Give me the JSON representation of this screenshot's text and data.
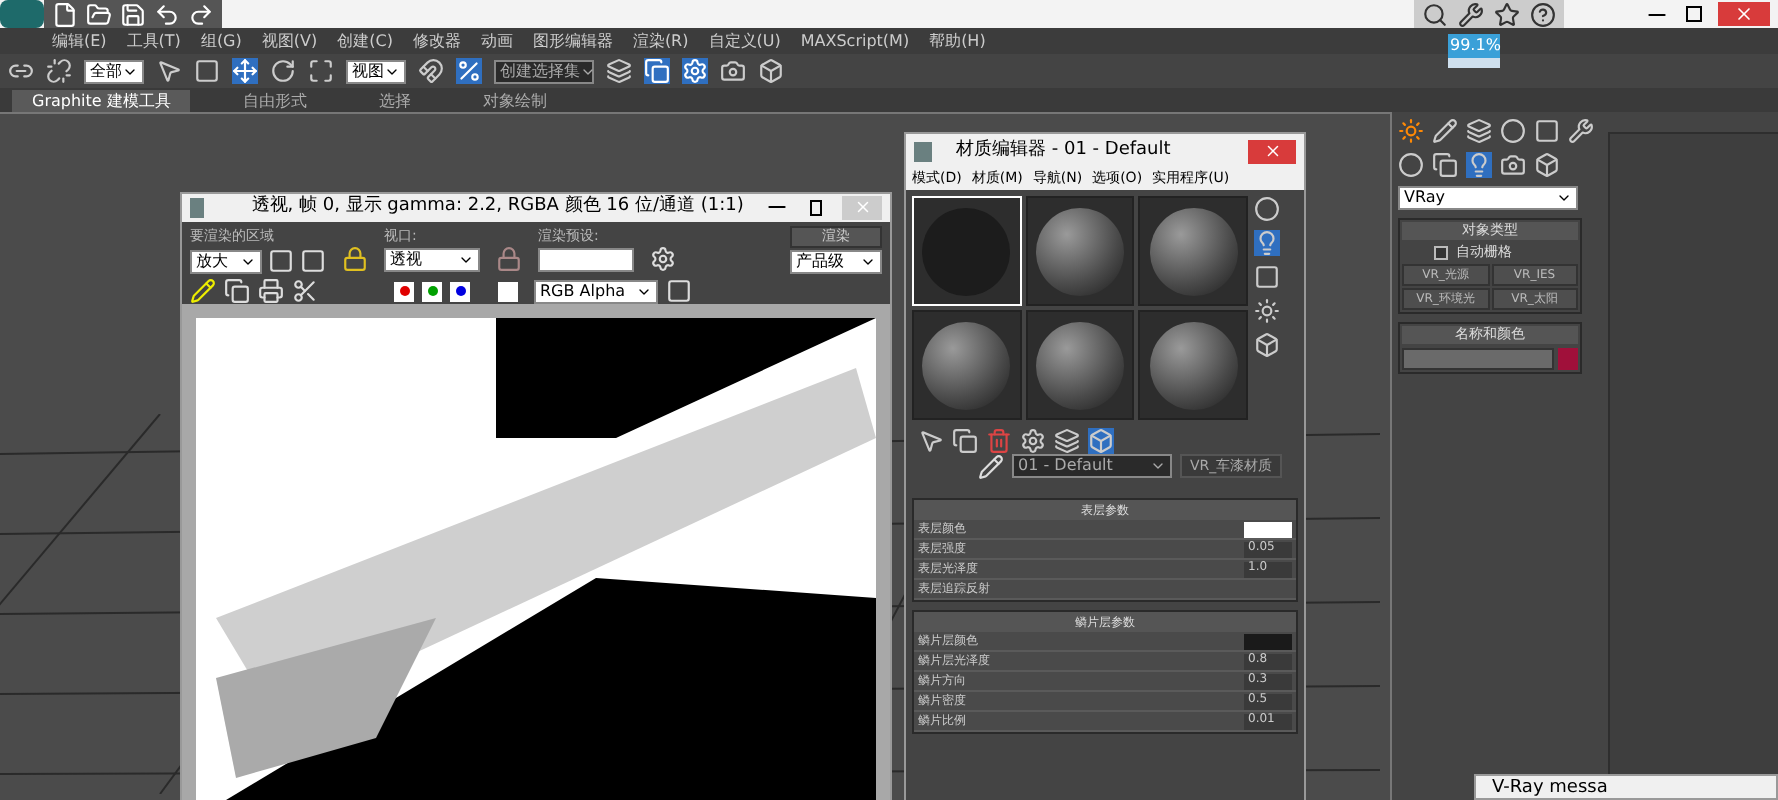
{
  "app": {
    "progress": "99.1%"
  },
  "menu": [
    "编辑(E)",
    "工具(T)",
    "组(G)",
    "视图(V)",
    "创建(C)",
    "修改器",
    "动画",
    "图形编辑器",
    "渲染(R)",
    "自定义(U)",
    "MAXScript(M)",
    "帮助(H)"
  ],
  "toolbar": {
    "filter": "全部",
    "coord": "视图",
    "selection_set": "创建选择集"
  },
  "ribbon_tabs": [
    {
      "label": "Graphite 建模工具",
      "selected": true
    },
    {
      "label": "自由形式",
      "selected": false
    },
    {
      "label": "选择",
      "selected": false
    },
    {
      "label": "对象绘制",
      "selected": false
    }
  ],
  "render_window": {
    "title": "透视, 帧 0, 显示 gamma: 2.2, RGBA 颜色 16 位/通道 (1:1)",
    "area_label": "要渲染的区域",
    "area_value": "放大",
    "viewport_label": "视口:",
    "viewport_value": "透视",
    "preset_label": "渲染预设:",
    "render_button": "渲染",
    "quality_value": "产品级",
    "channel_value": "RGB Alpha"
  },
  "material_editor": {
    "title": "材质编辑器 - 01 - Default",
    "menu": [
      "模式(D)",
      "材质(M)",
      "导航(N)",
      "选项(O)",
      "实用程序(U)"
    ],
    "slots": [
      {
        "selected": true
      },
      {
        "selected": false
      },
      {
        "selected": false
      },
      {
        "selected": false
      },
      {
        "selected": false
      },
      {
        "selected": false
      }
    ],
    "material_name": "01 - Default",
    "material_type": "VR_车漆材质",
    "sections": [
      {
        "title": "表层参数",
        "rows": [
          {
            "kind": "swatch",
            "label": "表层颜色",
            "color": "#ffffff"
          },
          {
            "kind": "value",
            "label": "表层强度",
            "value": "0.05"
          },
          {
            "kind": "value",
            "label": "表层光泽度",
            "value": "1.0"
          },
          {
            "kind": "text",
            "label": "表层追踪反射"
          }
        ]
      },
      {
        "title": "鳞片层参数",
        "rows": [
          {
            "kind": "swatch",
            "label": "鳞片层颜色",
            "color": "#1a1a1a"
          },
          {
            "kind": "value",
            "label": "鳞片层光泽度",
            "value": "0.8"
          },
          {
            "kind": "value",
            "label": "鳞片方向",
            "value": "0.3"
          },
          {
            "kind": "value",
            "label": "鳞片密度",
            "value": "0.5"
          },
          {
            "kind": "value",
            "label": "鳞片比例",
            "value": "0.01"
          }
        ]
      }
    ]
  },
  "command_panel": {
    "category": "VRay",
    "object_type": {
      "title": "对象类型",
      "autogrid": {
        "label": "自动栅格",
        "checked": false
      },
      "buttons": [
        "VR_光源",
        "VR_IES",
        "VR_环境光",
        "VR_太阳"
      ]
    },
    "name_color": {
      "title": "名称和颜色",
      "color": "#a0103a"
    }
  },
  "vray_window": {
    "title": "V-Ray messa"
  }
}
